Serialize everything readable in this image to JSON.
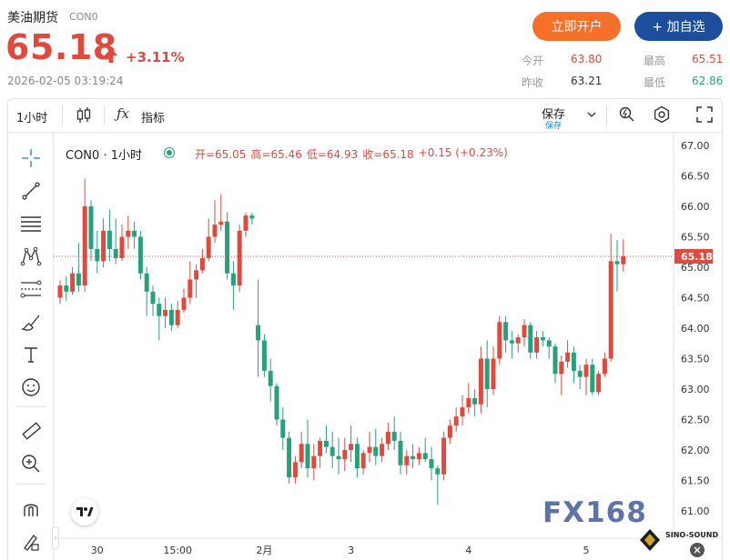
{
  "header": {
    "title": "美油期货",
    "code": "CON0",
    "price": "65.18",
    "change_pct": "+3.11%",
    "datetime": "2026-02-05 03:19:24",
    "btn_open": "立即开户",
    "btn_watch": "+ 加自选",
    "stats": {
      "open_label": "今开",
      "open_value": "63.80",
      "high_label": "最高",
      "high_value": "65.51",
      "prev_label": "昨收",
      "prev_value": "63.21",
      "low_label": "最低",
      "low_value": "62.86"
    }
  },
  "toolbar": {
    "interval": "1小时",
    "indicator_label": "指标",
    "save_label": "保存",
    "save_sub": "保存"
  },
  "legend": {
    "symbol": "CON0 · 1小时",
    "open": "开=65.05",
    "high": "高=65.46",
    "low": "低=64.93",
    "close": "收=65.18",
    "change": "+0.15 (+0.23%)"
  },
  "watermark": {
    "logo": "FX168",
    "badge": "SINO-SOUND"
  },
  "colors": {
    "up": "#e0493d",
    "down": "#26a17b",
    "accent": "#e0493d",
    "navy": "#1d4e9e",
    "orange": "#f7702a"
  },
  "chart_data": {
    "type": "candlestick",
    "y_ticks": [
      "67.00",
      "66.50",
      "66.00",
      "65.50",
      "65.00",
      "64.50",
      "64.00",
      "63.50",
      "63.00",
      "62.50",
      "62.00",
      "61.50",
      "61.00"
    ],
    "ylim": [
      60.9,
      67.0
    ],
    "x_ticks": [
      {
        "label": "30",
        "index": 6
      },
      {
        "label": "15:00",
        "index": 19
      },
      {
        "label": "2月",
        "index": 33
      },
      {
        "label": "3",
        "index": 47
      },
      {
        "label": "4",
        "index": 66
      },
      {
        "label": "5",
        "index": 85
      }
    ],
    "current_price": "65.18",
    "candles": [
      [
        64.5,
        64.78,
        64.4,
        64.7
      ],
      [
        64.7,
        64.85,
        64.45,
        64.6
      ],
      [
        64.6,
        65.0,
        64.55,
        64.9
      ],
      [
        64.9,
        65.4,
        64.6,
        64.7
      ],
      [
        64.7,
        66.45,
        64.6,
        66.0
      ],
      [
        66.0,
        66.1,
        65.1,
        65.3
      ],
      [
        65.3,
        65.6,
        64.9,
        65.1
      ],
      [
        65.1,
        65.8,
        65.0,
        65.6
      ],
      [
        65.6,
        65.95,
        65.1,
        65.3
      ],
      [
        65.3,
        65.8,
        65.05,
        65.15
      ],
      [
        65.15,
        65.7,
        65.1,
        65.5
      ],
      [
        65.5,
        65.85,
        65.3,
        65.6
      ],
      [
        65.6,
        65.75,
        65.3,
        65.5
      ],
      [
        65.5,
        65.6,
        64.8,
        64.9
      ],
      [
        64.9,
        65.0,
        64.2,
        64.6
      ],
      [
        64.6,
        64.7,
        64.2,
        64.4
      ],
      [
        64.4,
        64.5,
        63.8,
        64.2
      ],
      [
        64.2,
        64.5,
        64.0,
        64.3
      ],
      [
        64.3,
        64.4,
        63.95,
        64.05
      ],
      [
        64.05,
        64.45,
        64.0,
        64.3
      ],
      [
        64.3,
        64.65,
        64.25,
        64.5
      ],
      [
        64.5,
        65.1,
        64.4,
        64.8
      ],
      [
        64.8,
        65.05,
        64.5,
        64.95
      ],
      [
        64.95,
        65.3,
        64.9,
        65.15
      ],
      [
        65.15,
        65.8,
        65.1,
        65.5
      ],
      [
        65.5,
        66.1,
        65.4,
        65.7
      ],
      [
        65.7,
        66.2,
        65.6,
        65.75
      ],
      [
        65.75,
        65.9,
        64.8,
        64.9
      ],
      [
        64.9,
        65.1,
        64.3,
        64.7
      ],
      [
        64.7,
        65.7,
        64.6,
        65.6
      ],
      [
        65.6,
        65.9,
        65.5,
        65.85
      ],
      [
        65.85,
        65.9,
        65.7,
        65.8
      ],
      [
        64.05,
        64.8,
        63.2,
        63.8
      ],
      [
        63.8,
        63.9,
        63.2,
        63.3
      ],
      [
        63.3,
        63.5,
        62.8,
        63.05
      ],
      [
        63.05,
        63.1,
        62.4,
        62.5
      ],
      [
        62.5,
        62.7,
        62.0,
        62.2
      ],
      [
        62.2,
        62.3,
        61.45,
        61.55
      ],
      [
        61.55,
        61.9,
        61.45,
        61.8
      ],
      [
        61.8,
        62.3,
        61.7,
        62.1
      ],
      [
        62.1,
        62.5,
        61.55,
        61.7
      ],
      [
        61.7,
        62.1,
        61.5,
        61.9
      ],
      [
        61.9,
        62.2,
        61.7,
        62.15
      ],
      [
        62.15,
        62.4,
        61.95,
        62.05
      ],
      [
        62.05,
        62.3,
        61.7,
        61.9
      ],
      [
        61.9,
        62.2,
        61.6,
        61.85
      ],
      [
        61.85,
        62.2,
        61.65,
        62.0
      ],
      [
        62.0,
        62.4,
        61.8,
        62.1
      ],
      [
        62.1,
        62.2,
        61.55,
        61.7
      ],
      [
        61.7,
        62.0,
        61.6,
        61.95
      ],
      [
        61.95,
        62.3,
        61.8,
        62.05
      ],
      [
        62.05,
        62.35,
        61.75,
        61.9
      ],
      [
        61.9,
        62.2,
        61.8,
        62.1
      ],
      [
        62.1,
        62.45,
        62.0,
        62.3
      ],
      [
        62.3,
        62.55,
        62.0,
        62.15
      ],
      [
        62.15,
        62.3,
        61.6,
        61.75
      ],
      [
        61.75,
        62.0,
        61.6,
        61.9
      ],
      [
        61.9,
        62.1,
        61.7,
        61.85
      ],
      [
        61.85,
        62.05,
        61.75,
        61.95
      ],
      [
        61.95,
        62.2,
        61.8,
        61.85
      ],
      [
        61.85,
        62.05,
        61.5,
        61.7
      ],
      [
        61.7,
        61.75,
        61.1,
        61.6
      ],
      [
        61.6,
        62.3,
        61.5,
        62.2
      ],
      [
        62.2,
        62.5,
        62.1,
        62.4
      ],
      [
        62.4,
        62.7,
        62.3,
        62.55
      ],
      [
        62.55,
        62.9,
        62.4,
        62.7
      ],
      [
        62.7,
        63.1,
        62.6,
        62.85
      ],
      [
        62.85,
        63.0,
        62.55,
        62.75
      ],
      [
        62.75,
        63.7,
        62.6,
        63.5
      ],
      [
        63.5,
        63.8,
        62.7,
        63.0
      ],
      [
        63.0,
        63.7,
        62.9,
        63.5
      ],
      [
        63.5,
        64.2,
        63.4,
        64.1
      ],
      [
        64.1,
        64.2,
        63.6,
        63.8
      ],
      [
        63.8,
        63.95,
        63.5,
        63.75
      ],
      [
        63.75,
        63.9,
        63.6,
        63.85
      ],
      [
        63.85,
        64.15,
        63.7,
        64.05
      ],
      [
        64.05,
        64.1,
        63.5,
        63.6
      ],
      [
        63.6,
        63.95,
        63.5,
        63.85
      ],
      [
        63.85,
        63.95,
        63.7,
        63.8
      ],
      [
        63.8,
        63.85,
        63.5,
        63.7
      ],
      [
        63.7,
        63.75,
        63.1,
        63.25
      ],
      [
        63.25,
        63.55,
        62.9,
        63.45
      ],
      [
        63.45,
        63.8,
        63.35,
        63.6
      ],
      [
        63.6,
        63.7,
        63.1,
        63.3
      ],
      [
        63.3,
        63.4,
        63.0,
        63.2
      ],
      [
        63.2,
        63.5,
        62.9,
        63.4
      ],
      [
        63.4,
        63.5,
        62.9,
        62.95
      ],
      [
        62.95,
        63.3,
        62.9,
        63.25
      ],
      [
        63.25,
        63.6,
        63.2,
        63.5
      ],
      [
        63.5,
        65.55,
        63.45,
        65.1
      ],
      [
        65.1,
        65.45,
        64.6,
        65.05
      ],
      [
        65.05,
        65.46,
        64.93,
        65.18
      ]
    ]
  }
}
